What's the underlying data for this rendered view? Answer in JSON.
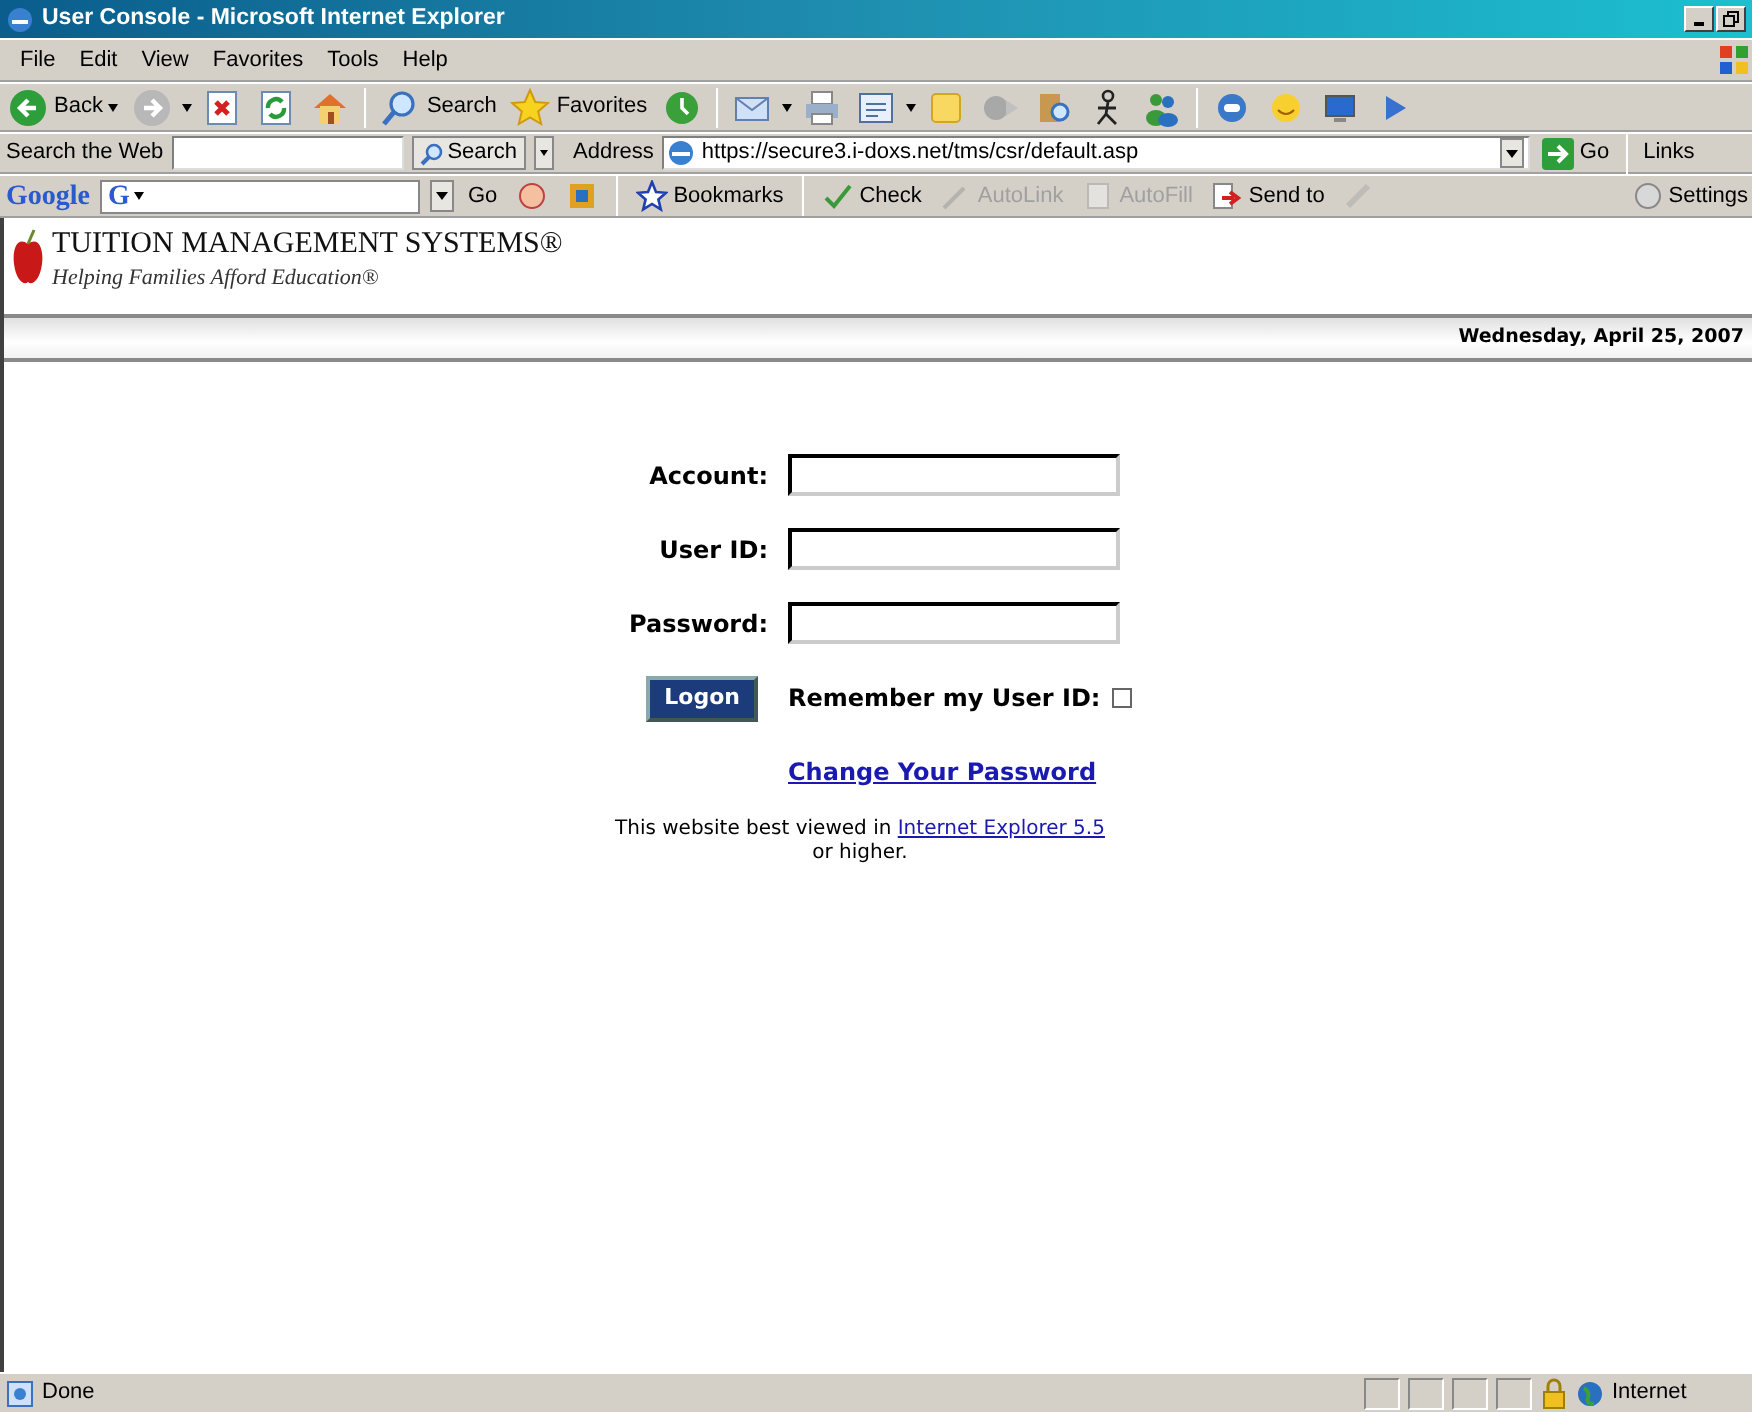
{
  "window": {
    "title": "User Console - Microsoft Internet Explorer"
  },
  "menu": [
    "File",
    "Edit",
    "View",
    "Favorites",
    "Tools",
    "Help"
  ],
  "toolbar": [
    {
      "kind": "back",
      "label": "Back",
      "dropdown": true
    },
    {
      "kind": "forward",
      "dropdown": true
    },
    {
      "kind": "stop"
    },
    {
      "kind": "refresh"
    },
    {
      "kind": "home"
    },
    {
      "kind": "sep"
    },
    {
      "kind": "search",
      "label": "Search"
    },
    {
      "kind": "favorites",
      "label": "Favorites"
    },
    {
      "kind": "history"
    },
    {
      "kind": "sep"
    },
    {
      "kind": "mail",
      "dropdown": true
    },
    {
      "kind": "print"
    },
    {
      "kind": "edit",
      "dropdown": true
    },
    {
      "kind": "note"
    },
    {
      "kind": "media"
    },
    {
      "kind": "research"
    },
    {
      "kind": "messenger"
    },
    {
      "kind": "people"
    },
    {
      "kind": "sep"
    },
    {
      "kind": "chat"
    },
    {
      "kind": "smiley"
    },
    {
      "kind": "monitor"
    },
    {
      "kind": "pointer"
    }
  ],
  "address_row": {
    "search_label": "Search the Web",
    "search_button": "Search",
    "address_label": "Address",
    "url": "https://secure3.i-doxs.net/tms/csr/default.asp",
    "go": "Go",
    "links": "Links"
  },
  "google_bar": {
    "logo": "Google",
    "g_button": "G",
    "items": [
      {
        "kind": "go",
        "label": "Go",
        "disabled": false
      },
      {
        "kind": "popup",
        "disabled": false
      },
      {
        "kind": "options",
        "disabled": false
      },
      {
        "kind": "bookmarks",
        "label": "Bookmarks",
        "disabled": false
      },
      {
        "kind": "check",
        "label": "Check",
        "disabled": false
      },
      {
        "kind": "autolink",
        "label": "AutoLink",
        "disabled": true
      },
      {
        "kind": "autofill",
        "label": "AutoFill",
        "disabled": true
      },
      {
        "kind": "sendto",
        "label": "Send to",
        "disabled": false
      },
      {
        "kind": "pen",
        "disabled": true
      }
    ],
    "settings": "Settings"
  },
  "page": {
    "brand": "TUITION MANAGEMENT SYSTEMS®",
    "tagline": "Helping Families Afford Education®",
    "date": "Wednesday, April 25, 2007",
    "fields": [
      {
        "label": "Account:"
      },
      {
        "label": "User ID:"
      },
      {
        "label": "Password:"
      }
    ],
    "logon_button": "Logon",
    "remember": {
      "label": "Remember my User ID:",
      "checked": false
    },
    "change_password": "Change Your Password",
    "note": {
      "text": "This website best viewed in",
      "link": "Internet Explorer 5.5",
      "tail": "or higher."
    }
  },
  "status_bar": {
    "text": "Done",
    "zone": "Internet"
  }
}
